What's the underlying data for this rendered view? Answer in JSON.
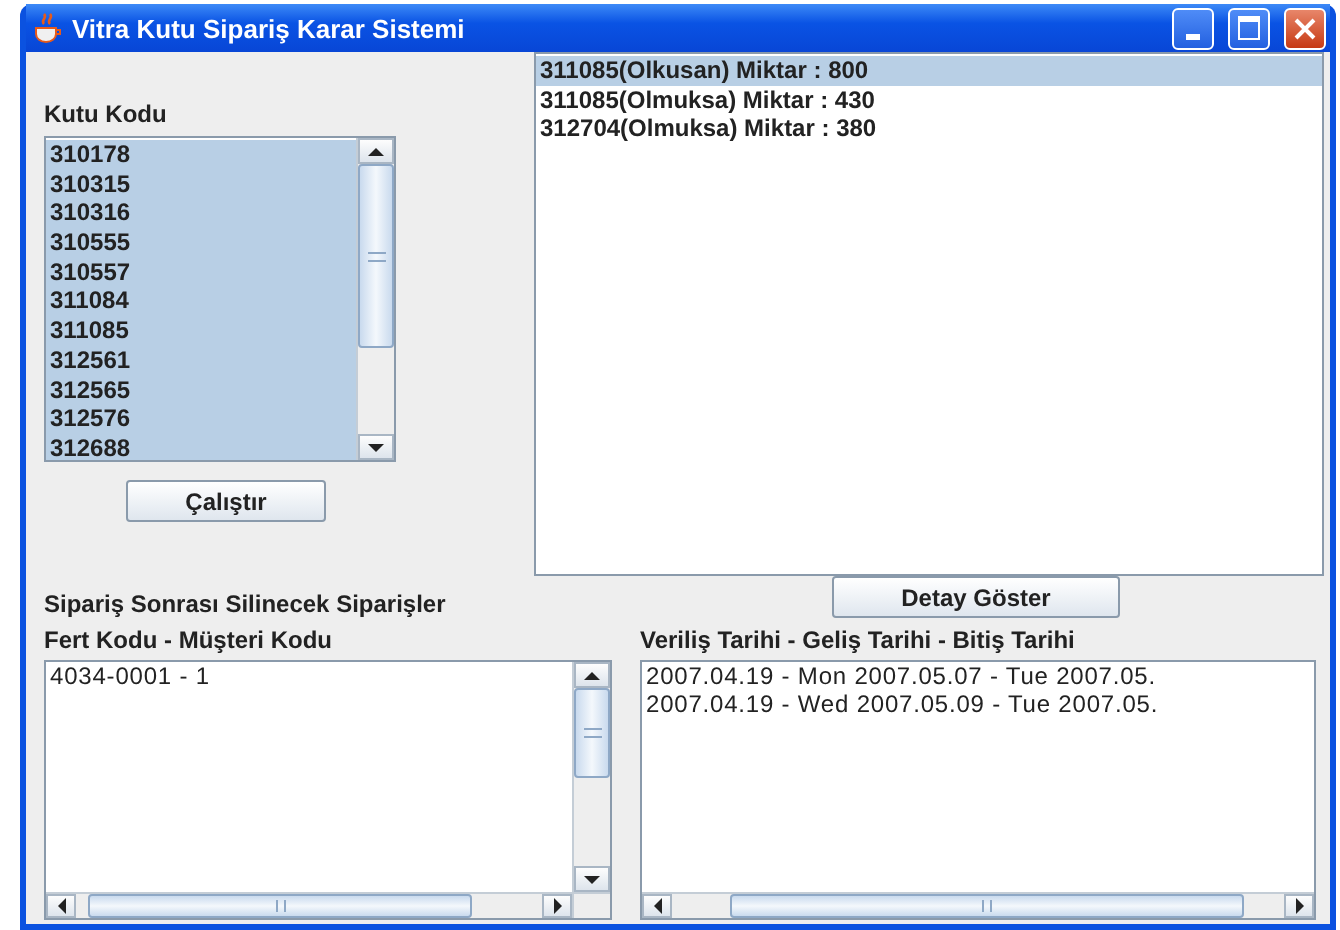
{
  "window": {
    "title": "Vitra Kutu Sipariş Karar Sistemi"
  },
  "box_code_list": {
    "label": "Kutu Kodu",
    "items": [
      {
        "text": "310178",
        "selected": true
      },
      {
        "text": "310315",
        "selected": true
      },
      {
        "text": "310316",
        "selected": true
      },
      {
        "text": "310555",
        "selected": true
      },
      {
        "text": "310557",
        "selected": true
      },
      {
        "text": "311084",
        "selected": true
      },
      {
        "text": "311085",
        "selected": true
      },
      {
        "text": "312561",
        "selected": true
      },
      {
        "text": "312565",
        "selected": true
      },
      {
        "text": "312576",
        "selected": true
      },
      {
        "text": "312688",
        "selected": true
      }
    ]
  },
  "run_button": {
    "label": "Çalıştır"
  },
  "order_list": {
    "items": [
      {
        "text": "311085(Olkusan) Miktar : 800",
        "selected": true
      },
      {
        "text": "311085(Olmuksa) Miktar : 430",
        "selected": false
      },
      {
        "text": "312704(Olmuksa) Miktar : 380",
        "selected": false
      }
    ]
  },
  "detail_button": {
    "label": "Detay Göster"
  },
  "deleted_orders": {
    "title": "Sipariş Sonrası Silinecek Siparişler",
    "customer_list": {
      "label": "Fert Kodu - Müşteri Kodu",
      "items": [
        "4034-0001 - 1"
      ]
    },
    "date_list": {
      "label": "Veriliş Tarihi - Geliş Tarihi - Bitiş Tarihi",
      "items": [
        "2007.04.19 - Mon 2007.05.07 - Tue 2007.05.",
        "2007.04.19 - Wed 2007.05.09 - Tue 2007.05."
      ]
    }
  }
}
